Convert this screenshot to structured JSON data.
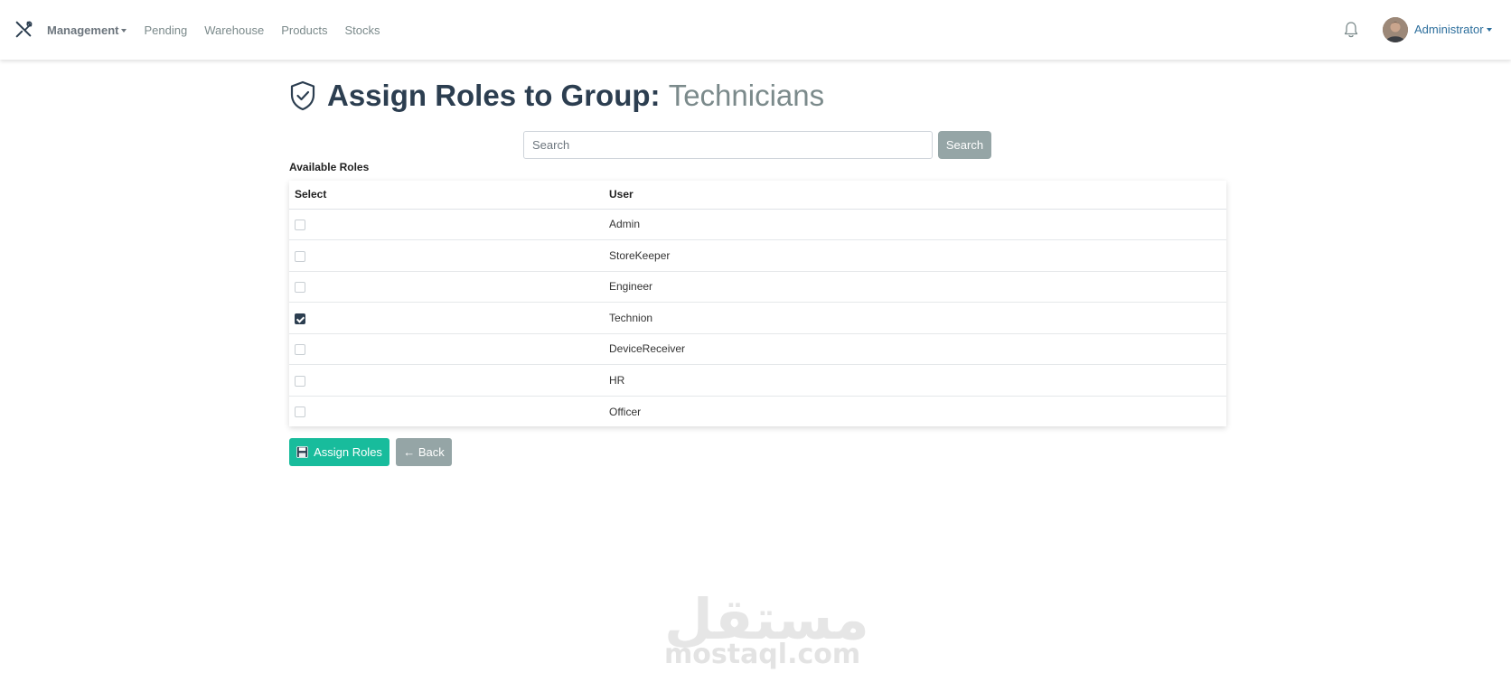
{
  "navbar": {
    "brand_icon": "tools-icon",
    "links": [
      {
        "label": "Management",
        "dropdown": true
      },
      {
        "label": "Pending"
      },
      {
        "label": "Warehouse"
      },
      {
        "label": "Products"
      },
      {
        "label": "Stocks"
      }
    ],
    "notification_icon": "bell-icon",
    "user": {
      "name": "Administrator"
    }
  },
  "page": {
    "title_prefix": "Assign Roles to Group: ",
    "group_name": "Technicians",
    "title_icon": "shield-check-icon"
  },
  "search": {
    "placeholder": "Search",
    "value": "",
    "button_label": "Search"
  },
  "section_label": "Available Roles",
  "table": {
    "headers": [
      "Select",
      "User"
    ],
    "rows": [
      {
        "checked": false,
        "name": "Admin"
      },
      {
        "checked": false,
        "name": "StoreKeeper"
      },
      {
        "checked": false,
        "name": "Engineer"
      },
      {
        "checked": true,
        "name": "Technion"
      },
      {
        "checked": false,
        "name": "DeviceReceiver"
      },
      {
        "checked": false,
        "name": "HR"
      },
      {
        "checked": false,
        "name": "Officer"
      }
    ]
  },
  "actions": {
    "assign_label": "Assign Roles",
    "assign_icon": "floppy-disk-icon",
    "back_label": "← Back"
  },
  "watermark": {
    "arabic": "مستقل",
    "latin": "mostaql.com"
  },
  "colors": {
    "primary_text": "#2c3e50",
    "success": "#18bc9c",
    "secondary": "#95a5a6",
    "link_user": "#2c6e9c"
  }
}
